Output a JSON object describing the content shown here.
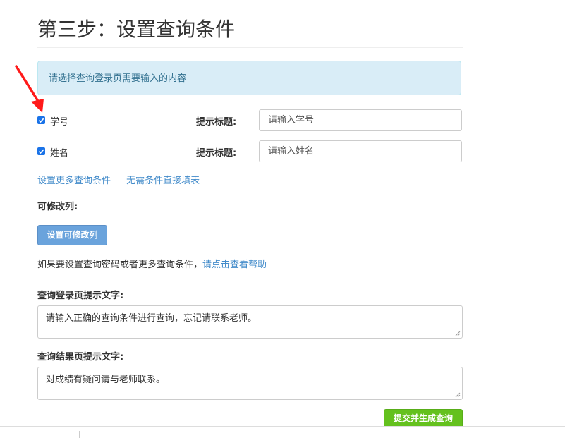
{
  "page_title": "第三步：设置查询条件",
  "info_message": "请选择查询登录页需要输入的内容",
  "fields": [
    {
      "name": "学号",
      "checked": true,
      "hint_label": "提示标题:",
      "hint_value": "请输入学号"
    },
    {
      "name": "姓名",
      "checked": true,
      "hint_label": "提示标题:",
      "hint_value": "请输入姓名"
    }
  ],
  "links": {
    "more_conditions": "设置更多查询条件",
    "no_conditions": "无需条件直接填表"
  },
  "editable": {
    "label": "可修改列:",
    "button": "设置可修改列"
  },
  "help": {
    "text": "如果要设置查询密码或者更多查询条件，",
    "link": "请点击查看帮助"
  },
  "login_hint": {
    "label": "查询登录页提示文字:",
    "value": "请输入正确的查询条件进行查询，忘记请联系老师。"
  },
  "result_hint": {
    "label": "查询结果页提示文字:",
    "value": "对成绩有疑问请与老师联系。"
  },
  "submit_button": "提交并生成查询",
  "colors": {
    "info_bg": "#d9edf7",
    "link": "#428bca",
    "primary_button": "#6aa3dc",
    "submit_button": "#64c11e",
    "annotation_arrow": "#ff1a1a",
    "checkbox": "#1a73e8"
  },
  "icons": {
    "annotation": "red-arrow-icon",
    "checkbox": "checkmark-icon",
    "resize": "resize-grip-icon"
  }
}
